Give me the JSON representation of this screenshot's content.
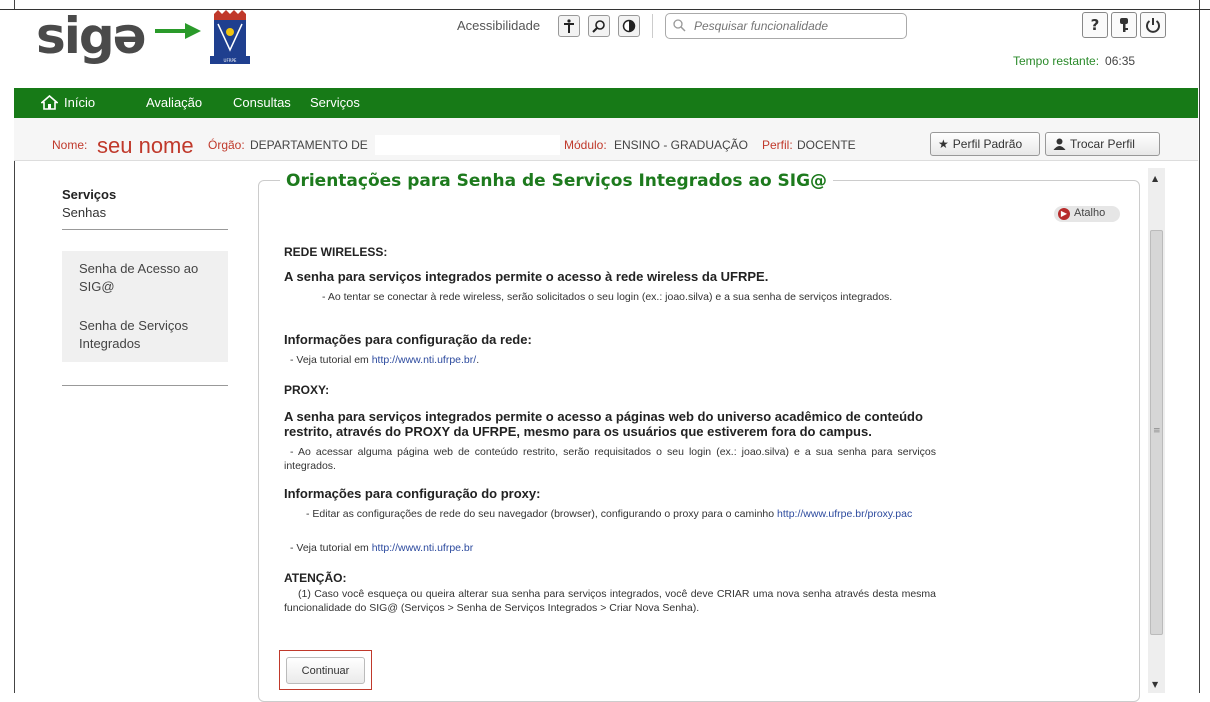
{
  "header": {
    "logo": "sigə",
    "accessibility_label": "Acessibilidade",
    "search_placeholder": "Pesquisar funcionalidade",
    "help_label": "?",
    "timer_label": "Tempo restante:",
    "timer_value": "06:35"
  },
  "nav": {
    "items": [
      "Início",
      "Avaliação",
      "Consultas",
      "Serviços"
    ]
  },
  "info": {
    "nome_label": "Nome:",
    "nome_value": "seu nome",
    "orgao_label": "Órgão:",
    "orgao_value": "DEPARTAMENTO DE",
    "modulo_label": "Módulo:",
    "modulo_value": "ENSINO - GRADUAÇÃO",
    "perfil_label": "Perfil:",
    "perfil_value": "DOCENTE",
    "perfil_padrao": "Perfil Padrão",
    "trocar_perfil": "Trocar Perfil"
  },
  "sidebar": {
    "title": "Serviços",
    "subtitle": "Senhas",
    "items": [
      "Senha de Acesso ao SIG@",
      "Senha de Serviços Integrados"
    ]
  },
  "main": {
    "title": "Orientações para Senha de Serviços Integrados ao SIG@",
    "shortcut": "Atalho",
    "s1_heading": "REDE WIRELESS:",
    "s1_bold": "A senha para serviços integrados permite o acesso à rede wireless da UFRPE.",
    "s1_text": "- Ao tentar se conectar à rede wireless, serão solicitados o seu login (ex.: joao.silva) e a sua senha de serviços integrados.",
    "s1_info": "Informações para configuração da rede:",
    "s1_tutorial_prefix": "- Veja tutorial em",
    "s1_tutorial_link": "http://www.nti.ufrpe.br/",
    "s2_heading": "PROXY:",
    "s2_bold": "A senha para serviços integrados permite o acesso a páginas web do universo acadêmico de conteúdo restrito, através do PROXY da UFRPE, mesmo para os usuários que estiverem fora do campus.",
    "s2_text": "- Ao acessar alguma página web de conteúdo restrito, serão requisitados o seu login (ex.: joao.silva) e a sua senha para serviços integrados.",
    "s2_info": "Informações para configuração do proxy:",
    "s2_edit": "- Editar as configurações de rede do seu navegador (browser), configurando o proxy para o caminho",
    "s2_proxy_link": "http://www.ufrpe.br/proxy.pac",
    "s2_tutorial_prefix": "- Veja tutorial em",
    "s2_tutorial_link": "http://www.nti.ufrpe.br",
    "s3_heading": "ATENÇÃO:",
    "s3_text": "(1) Caso você esqueça ou queira alterar sua senha para serviços integrados, você deve CRIAR uma nova senha através desta mesma funcionalidade do SIG@ (Serviços > Senha de Serviços Integrados > Criar Nova Senha).",
    "continue_button": "Continuar"
  },
  "colors": {
    "nav_green": "#177a17",
    "title_green": "#1d7a1d",
    "name_red": "#c0392b",
    "link_blue": "#2c4a9e"
  },
  "icons": [
    "home-icon",
    "accessibility-icon",
    "zoom-icon",
    "contrast-icon",
    "search-icon",
    "help-icon",
    "key-icon",
    "power-icon",
    "pin-icon",
    "user-icon",
    "shortcut-icon"
  ]
}
